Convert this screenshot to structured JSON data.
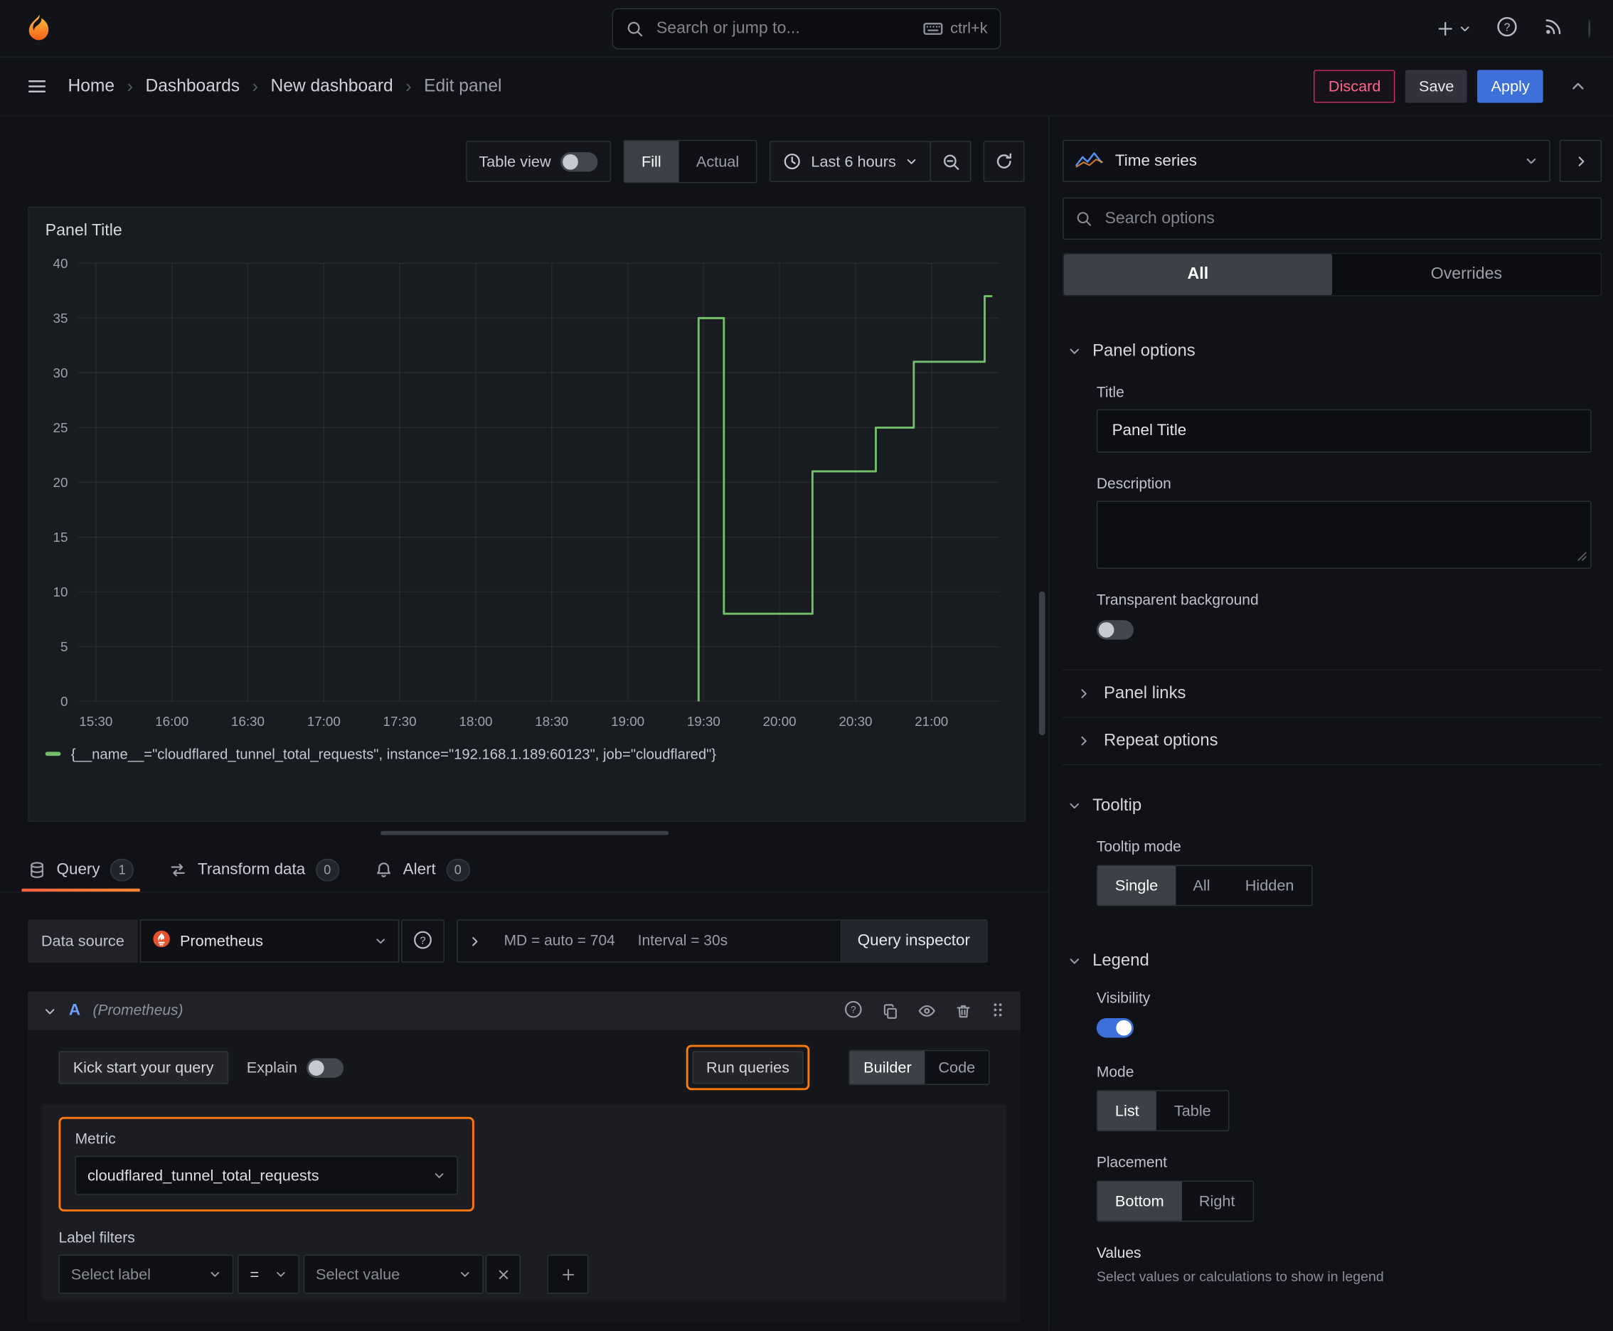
{
  "colors": {
    "accent_orange": "#ff780a",
    "series_green": "#73bf69",
    "primary_blue": "#3d71d9",
    "destructive_pink": "#d12d66",
    "tab_underline": "#f55f3e",
    "page_background": "#111217",
    "panel_background": "#181b1f"
  },
  "icons": {
    "topbar": [
      "grafana-logo",
      "search",
      "keyboard",
      "plus",
      "chevron-down",
      "help-circle",
      "rss",
      "avatar"
    ],
    "breadcrumb_bar": [
      "menu",
      "chevron-up"
    ],
    "toolbar": [
      "clock",
      "chevron-down",
      "zoom-out",
      "refresh"
    ],
    "tabs": [
      "database",
      "transform-arrows",
      "bell"
    ],
    "query": [
      "prometheus-logo",
      "help-circle",
      "chevron-right",
      "chevron-down",
      "copy",
      "eye",
      "trash",
      "drag-grip",
      "close",
      "plus"
    ],
    "options": [
      "timeseries-mini-chart",
      "search",
      "chevron-right",
      "chevron-down",
      "resize-corner"
    ]
  },
  "topbar": {
    "search_placeholder": "Search or jump to...",
    "search_shortcut": "ctrl+k"
  },
  "breadcrumb": {
    "separator": "›",
    "items": [
      "Home",
      "Dashboards",
      "New dashboard",
      "Edit panel"
    ],
    "discard_label": "Discard",
    "save_label": "Save",
    "apply_label": "Apply"
  },
  "toolbar": {
    "table_view_label": "Table view",
    "fill_label": "Fill",
    "actual_label": "Actual",
    "time_range_label": "Last 6 hours"
  },
  "panel": {
    "title": "Panel Title"
  },
  "chart_data": {
    "type": "line",
    "title": "Panel Title",
    "grid": true,
    "legend_position": "bottom",
    "ylim": [
      0,
      40
    ],
    "y_ticks": [
      0,
      5,
      10,
      15,
      20,
      25,
      30,
      35,
      40
    ],
    "x_domain_minutes": [
      923,
      1287
    ],
    "x_tick_minutes": [
      930,
      960,
      990,
      1020,
      1050,
      1080,
      1110,
      1140,
      1170,
      1200,
      1230,
      1260
    ],
    "x_tick_labels": [
      "15:30",
      "16:00",
      "16:30",
      "17:00",
      "17:30",
      "18:00",
      "18:30",
      "19:00",
      "19:30",
      "20:00",
      "20:30",
      "21:00"
    ],
    "series": [
      {
        "name": "{__name__=\"cloudflared_tunnel_total_requests\", instance=\"192.168.1.189:60123\", job=\"cloudflared\"}",
        "color": "#73bf69",
        "points": [
          [
            1168,
            0
          ],
          [
            1168,
            35
          ],
          [
            1178,
            35
          ],
          [
            1178,
            8
          ],
          [
            1213,
            8
          ],
          [
            1213,
            21
          ],
          [
            1238,
            21
          ],
          [
            1238,
            25
          ],
          [
            1253,
            25
          ],
          [
            1253,
            31
          ],
          [
            1281,
            31
          ],
          [
            1281,
            37
          ],
          [
            1284,
            37
          ]
        ]
      }
    ]
  },
  "tabs": {
    "query_label": "Query",
    "query_count": "1",
    "transform_label": "Transform data",
    "transform_count": "0",
    "alert_label": "Alert",
    "alert_count": "0"
  },
  "query_editor": {
    "datasource_label": "Data source",
    "datasource_value": "Prometheus",
    "options_summary": "MD = auto = 704",
    "interval_summary": "Interval = 30s",
    "query_inspector_label": "Query inspector",
    "ref_id": "A",
    "ref_datasource": "(Prometheus)",
    "kick_start_label": "Kick start your query",
    "explain_label": "Explain",
    "run_queries_label": "Run queries",
    "builder_label": "Builder",
    "code_label": "Code",
    "metric_label": "Metric",
    "metric_value": "cloudflared_tunnel_total_requests",
    "label_filters_label": "Label filters",
    "select_label_placeholder": "Select label",
    "operator_value": "=",
    "select_value_placeholder": "Select value"
  },
  "options_pane": {
    "viz_name": "Time series",
    "search_placeholder": "Search options",
    "tab_all": "All",
    "tab_overrides": "Overrides",
    "panel_options": {
      "heading": "Panel options",
      "title_label": "Title",
      "title_value": "Panel Title",
      "description_label": "Description",
      "transparent_label": "Transparent background"
    },
    "panel_links_label": "Panel links",
    "repeat_options_label": "Repeat options",
    "tooltip": {
      "heading": "Tooltip",
      "mode_label": "Tooltip mode",
      "options": [
        "Single",
        "All",
        "Hidden"
      ],
      "selected": "Single"
    },
    "legend": {
      "heading": "Legend",
      "visibility_label": "Visibility",
      "mode_label": "Mode",
      "mode_options": [
        "List",
        "Table"
      ],
      "mode_selected": "List",
      "placement_label": "Placement",
      "placement_options": [
        "Bottom",
        "Right"
      ],
      "placement_selected": "Bottom",
      "values_label": "Values",
      "values_description": "Select values or calculations to show in legend"
    }
  }
}
